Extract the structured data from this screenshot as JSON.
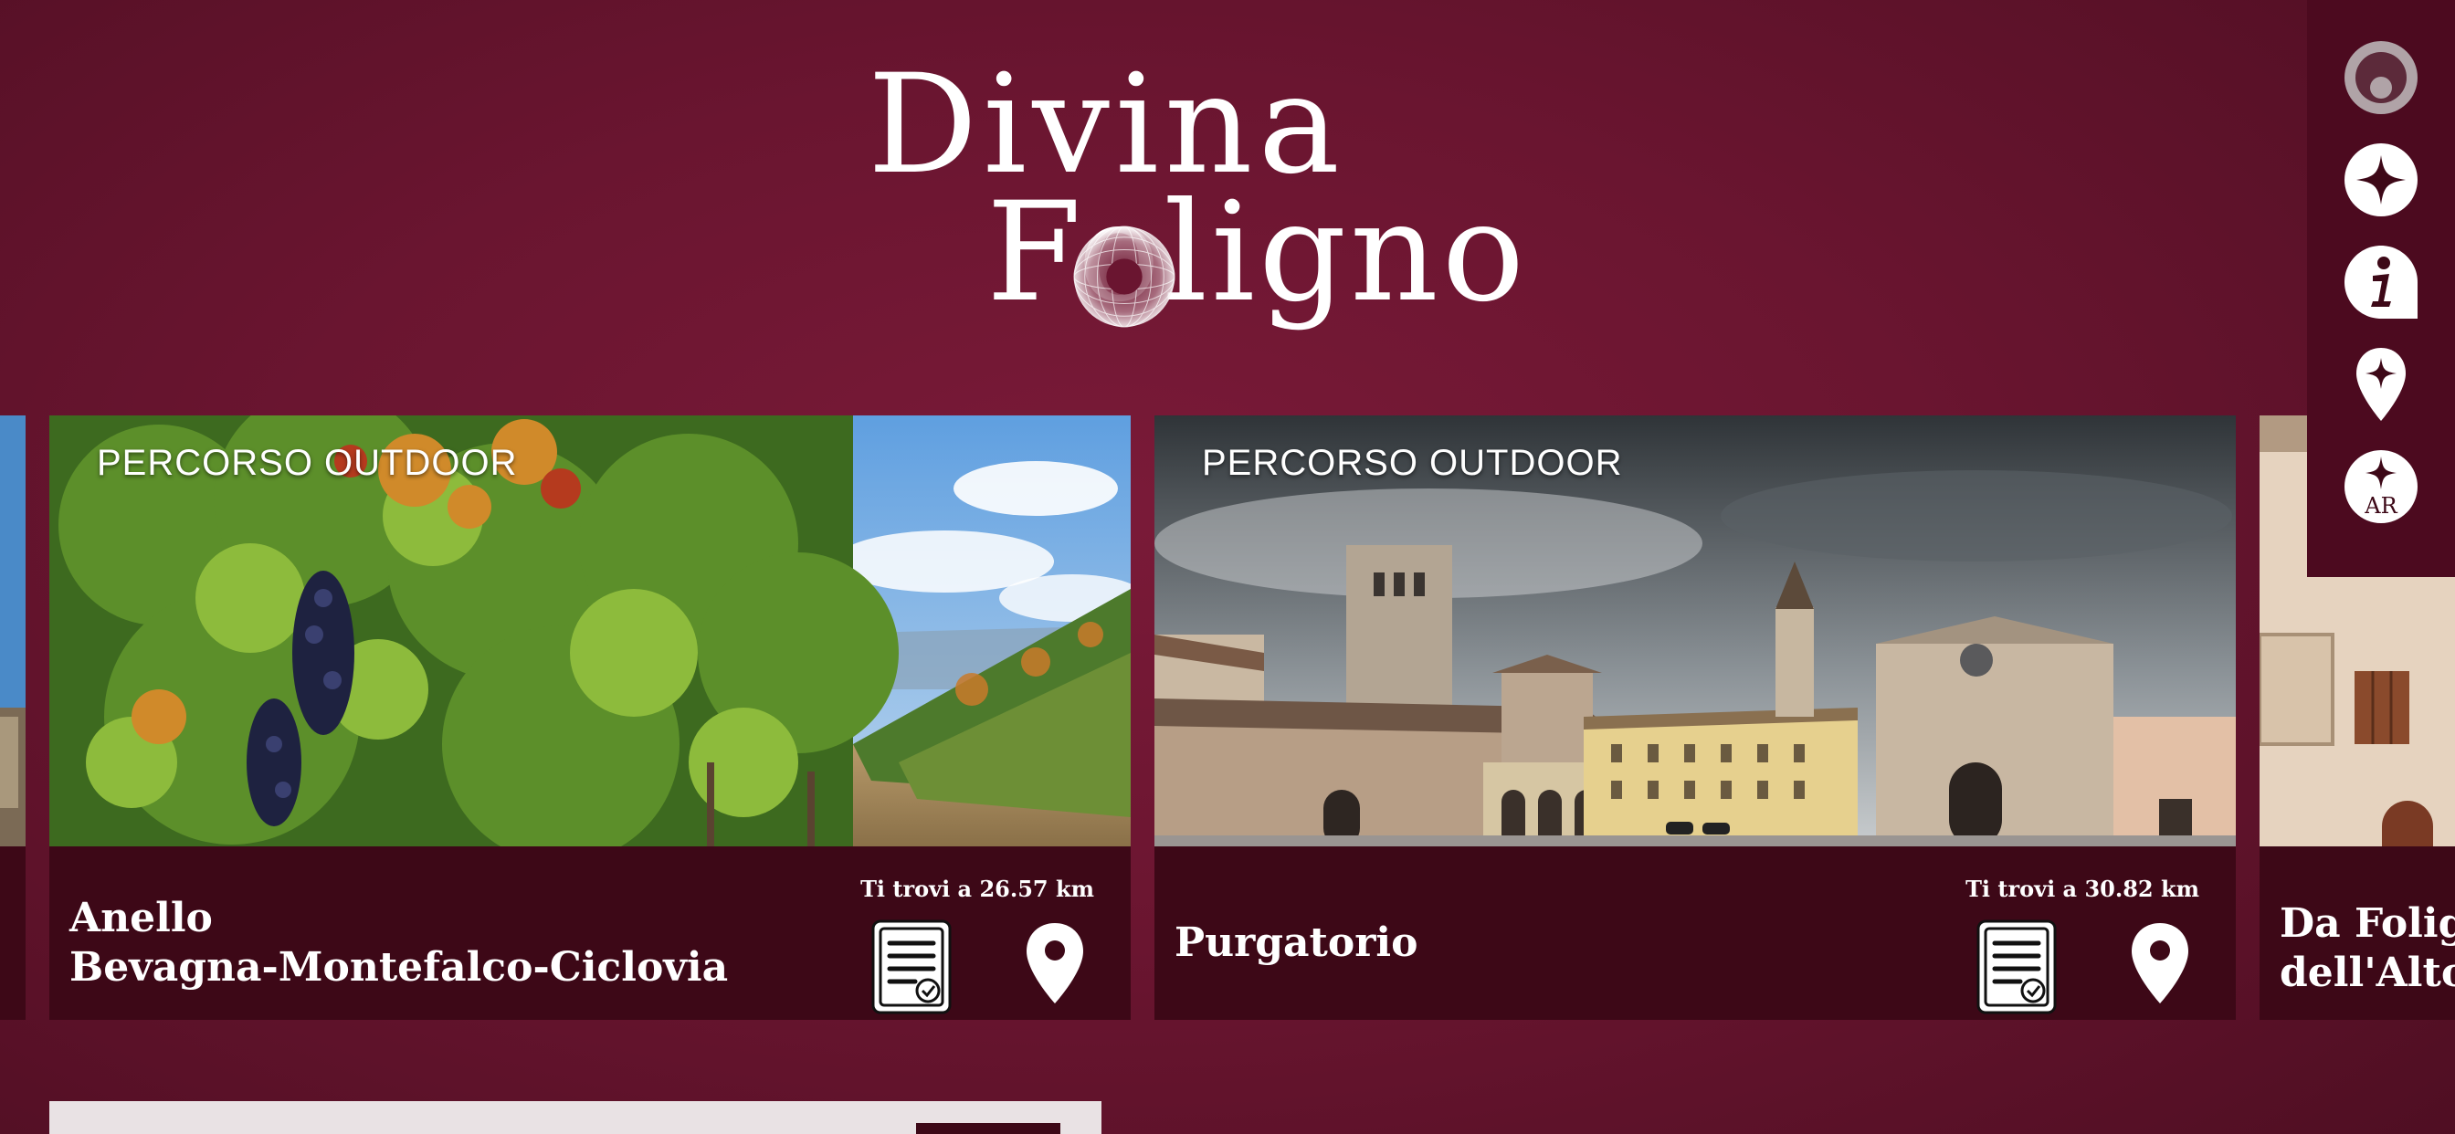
{
  "logo": {
    "line1": "Divina",
    "line2": "Foligno",
    "name": "Divina Foligno"
  },
  "toolbar": {
    "items": [
      {
        "icon": "profile-icon",
        "label": "profilo"
      },
      {
        "icon": "star-icon",
        "label": "preferiti"
      },
      {
        "icon": "info-icon",
        "label": "info"
      },
      {
        "icon": "map-pin-star-icon",
        "label": "mappa"
      },
      {
        "icon": "ar-icon",
        "label": "AR"
      }
    ],
    "ar_text": "AR"
  },
  "cards": [
    {
      "tag": "PERCORSO OUTDOOR",
      "title_line1": "Anello",
      "title_line2": "Bevagna-Montefalco-Ciclovia",
      "distance": "Ti trovi a 26.57 km",
      "image": "vineyard"
    },
    {
      "tag": "PERCORSO OUTDOOR",
      "title_line1": "Purgatorio",
      "distance": "Ti trovi a 30.82 km",
      "image": "church-square"
    },
    {
      "title_line1": "Da Folig",
      "title_line2": "dell'Alto",
      "image": "building-facade"
    }
  ],
  "colors": {
    "background": "#6a1530",
    "card_footer": "#3d0817",
    "toolbar": "#4c0a1f",
    "accent": "#ffffff"
  }
}
